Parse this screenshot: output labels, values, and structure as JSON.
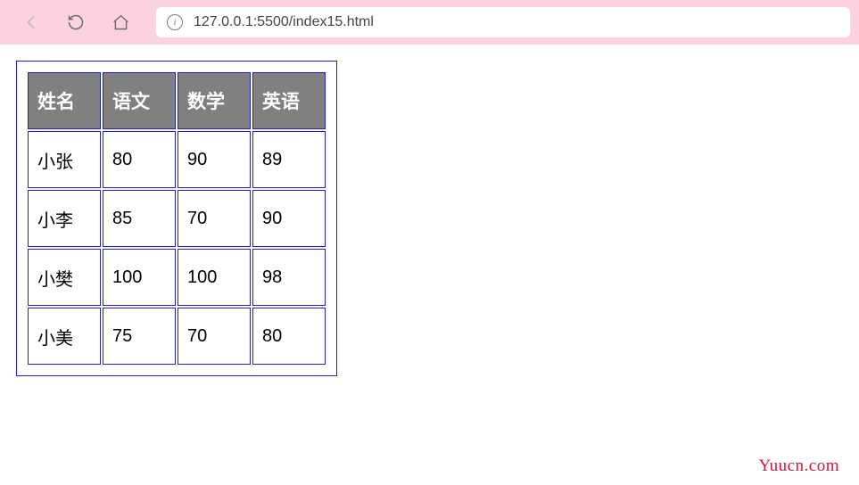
{
  "browser": {
    "url": "127.0.0.1:5500/index15.html"
  },
  "table": {
    "headers": [
      "姓名",
      "语文",
      "数学",
      "英语"
    ],
    "rows": [
      {
        "name": "小张",
        "c0": "80",
        "c1": "90",
        "c2": "89"
      },
      {
        "name": "小李",
        "c0": "85",
        "c1": "70",
        "c2": "90"
      },
      {
        "name": "小樊",
        "c0": "100",
        "c1": "100",
        "c2": "98"
      },
      {
        "name": "小美",
        "c0": "75",
        "c1": "70",
        "c2": "80"
      }
    ]
  },
  "watermark": "Yuucn.com",
  "chart_data": {
    "type": "table",
    "title": "",
    "columns": [
      "姓名",
      "语文",
      "数学",
      "英语"
    ],
    "rows": [
      [
        "小张",
        80,
        90,
        89
      ],
      [
        "小李",
        85,
        70,
        90
      ],
      [
        "小樊",
        100,
        100,
        98
      ],
      [
        "小美",
        75,
        70,
        80
      ]
    ]
  }
}
